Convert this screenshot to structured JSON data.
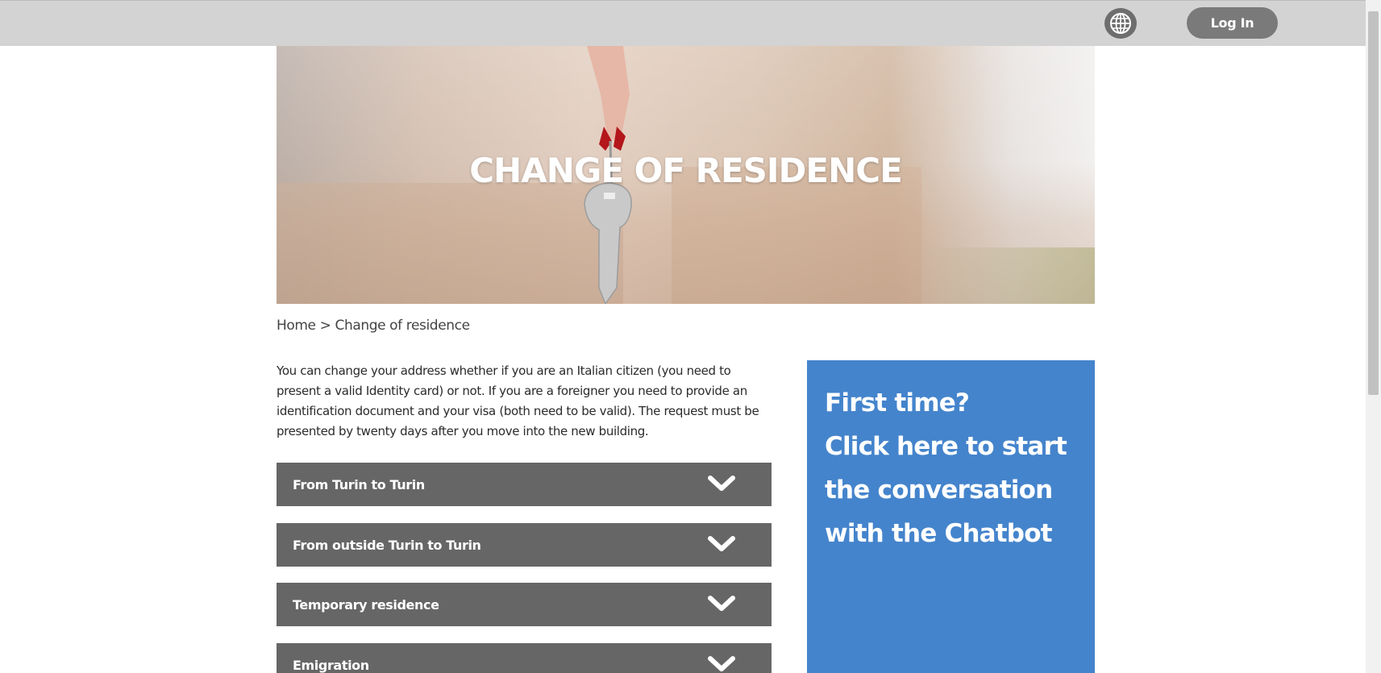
{
  "header": {
    "language_icon": "globe-icon",
    "login_label": "Log In"
  },
  "hero": {
    "title": "CHANGE OF RESIDENCE"
  },
  "breadcrumb": {
    "home": "Home",
    "separator": " > ",
    "current": "Change of residence"
  },
  "intro": {
    "text": "You can change your address whether if you are an Italian citizen (you need to present a valid Identity card) or not. If you are a foreigner you need to provide an identification document and your visa (both need to be valid). The request must be presented by twenty days after you move into the new building."
  },
  "accordion": {
    "items": [
      {
        "label": "From Turin to Turin"
      },
      {
        "label": "From outside Turin to Turin"
      },
      {
        "label": "Temporary residence"
      },
      {
        "label": "Emigration"
      }
    ],
    "icon": "chevron-down-icon"
  },
  "chatbot": {
    "line1": "First time?",
    "line2": "Click here to start",
    "line3": "the conversation",
    "line4": "with the Chatbot",
    "color": "#4484cc"
  },
  "colors": {
    "topbar": "#d3d3d3",
    "accordion": "#666666",
    "login_button": "#7a7a7a"
  }
}
